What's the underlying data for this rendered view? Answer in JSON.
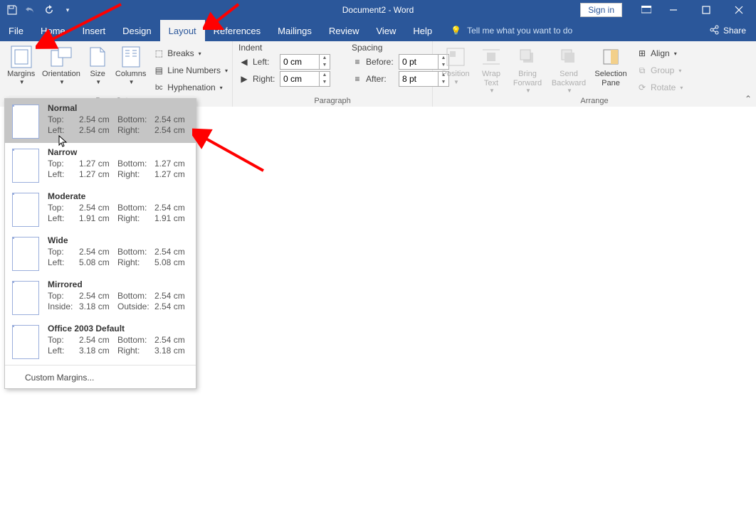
{
  "titlebar": {
    "title": "Document2 - Word",
    "signin": "Sign in"
  },
  "tabs": {
    "file": "File",
    "home": "Home",
    "insert": "Insert",
    "design": "Design",
    "layout": "Layout",
    "references": "References",
    "mailings": "Mailings",
    "review": "Review",
    "view": "View",
    "help": "Help",
    "tellme": "Tell me what you want to do",
    "share": "Share"
  },
  "ribbon": {
    "pagesetup": {
      "label": "Page Setup",
      "margins": "Margins",
      "orientation": "Orientation",
      "size": "Size",
      "columns": "Columns",
      "breaks": "Breaks",
      "lines": "Line Numbers",
      "hyphen": "Hyphenation"
    },
    "paragraph": {
      "label": "Paragraph",
      "indent": "Indent",
      "left": "Left:",
      "right": "Right:",
      "left_v": "0 cm",
      "right_v": "0 cm",
      "spacing": "Spacing",
      "before": "Before:",
      "after": "After:",
      "before_v": "0 pt",
      "after_v": "8 pt"
    },
    "arrange": {
      "label": "Arrange",
      "position": "Position",
      "wrap": "Wrap Text",
      "forward": "Bring Forward",
      "backward": "Send Backward",
      "selection": "Selection Pane",
      "align": "Align",
      "group": "Group",
      "rotate": "Rotate"
    }
  },
  "margins_menu": {
    "items": [
      {
        "name": "Normal",
        "l1": "Top:",
        "v1": "2.54 cm",
        "l2": "Bottom:",
        "v2": "2.54 cm",
        "l3": "Left:",
        "v3": "2.54 cm",
        "l4": "Right:",
        "v4": "2.54 cm"
      },
      {
        "name": "Narrow",
        "l1": "Top:",
        "v1": "1.27 cm",
        "l2": "Bottom:",
        "v2": "1.27 cm",
        "l3": "Left:",
        "v3": "1.27 cm",
        "l4": "Right:",
        "v4": "1.27 cm"
      },
      {
        "name": "Moderate",
        "l1": "Top:",
        "v1": "2.54 cm",
        "l2": "Bottom:",
        "v2": "2.54 cm",
        "l3": "Left:",
        "v3": "1.91 cm",
        "l4": "Right:",
        "v4": "1.91 cm"
      },
      {
        "name": "Wide",
        "l1": "Top:",
        "v1": "2.54 cm",
        "l2": "Bottom:",
        "v2": "2.54 cm",
        "l3": "Left:",
        "v3": "5.08 cm",
        "l4": "Right:",
        "v4": "5.08 cm"
      },
      {
        "name": "Mirrored",
        "l1": "Top:",
        "v1": "2.54 cm",
        "l2": "Bottom:",
        "v2": "2.54 cm",
        "l3": "Inside:",
        "v3": "3.18 cm",
        "l4": "Outside:",
        "v4": "2.54 cm"
      },
      {
        "name": "Office 2003 Default",
        "l1": "Top:",
        "v1": "2.54 cm",
        "l2": "Bottom:",
        "v2": "2.54 cm",
        "l3": "Left:",
        "v3": "3.18 cm",
        "l4": "Right:",
        "v4": "3.18 cm"
      }
    ],
    "custom": "Custom Margins..."
  }
}
